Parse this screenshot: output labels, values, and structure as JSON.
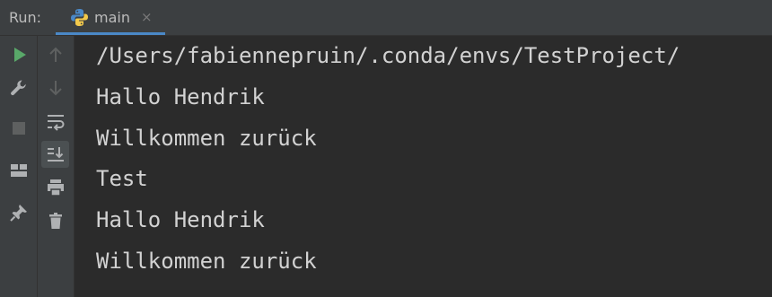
{
  "run_label": "Run:",
  "tab": {
    "label": "main",
    "close_glyph": "×",
    "icon": "python-icon"
  },
  "toolbar_left": [
    "rerun-icon",
    "wrench-icon",
    "stop-icon",
    "layout-icon",
    "pin-icon"
  ],
  "toolbar_right": [
    "arrow-up-icon",
    "arrow-down-icon",
    "soft-wrap-icon",
    "scroll-to-end-icon",
    "print-icon",
    "trash-icon"
  ],
  "colors": {
    "accent": "#4a88c7",
    "run_green": "#59a869",
    "background": "#2b2b2b",
    "panel": "#3c3f41",
    "text": "#d2d2d2"
  },
  "console": {
    "lines": [
      "/Users/fabiennepruin/.conda/envs/TestProject/",
      "Hallo Hendrik",
      "Willkommen zurück",
      "Test",
      "Hallo Hendrik",
      "Willkommen zurück"
    ]
  }
}
